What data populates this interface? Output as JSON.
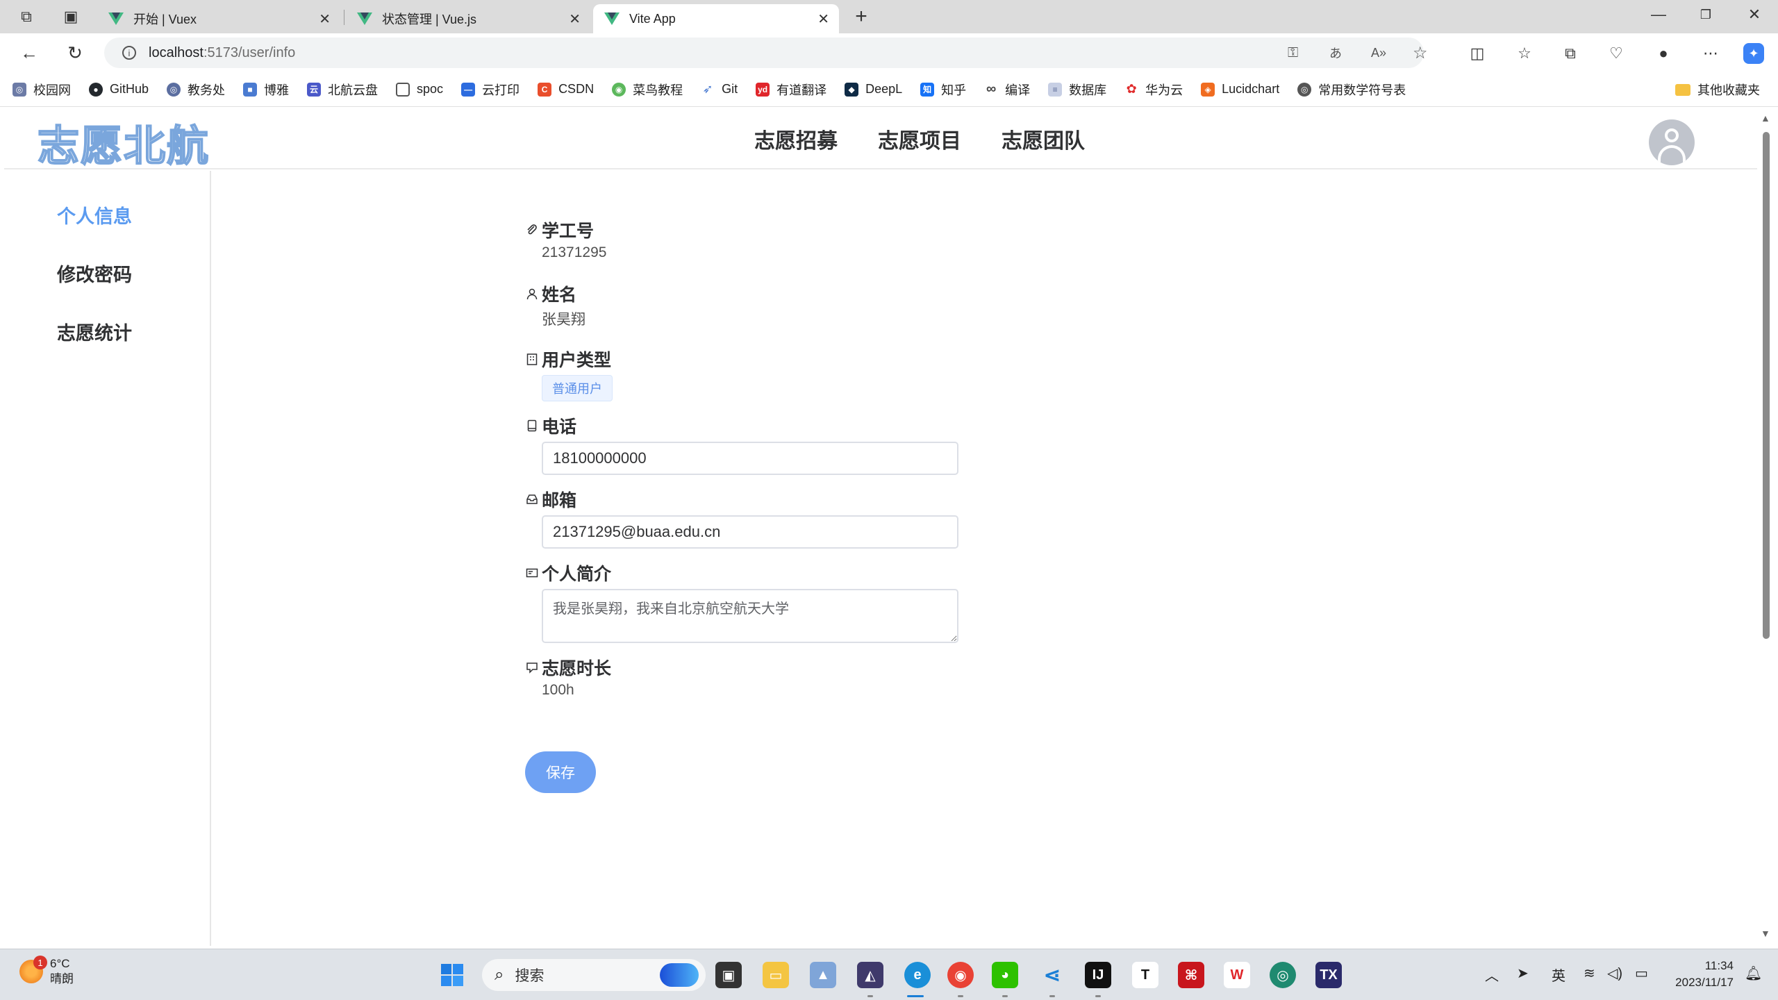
{
  "browser": {
    "tabs": [
      {
        "title": "开始 | Vuex"
      },
      {
        "title": "状态管理 | Vue.js"
      },
      {
        "title": "Vite App"
      }
    ],
    "new_tab": "+",
    "url_host": "localhost",
    "url_path": ":5173/user/info",
    "bookmarks": [
      {
        "label": "校园网",
        "color": "#6c7ba6",
        "glyph": "◎"
      },
      {
        "label": "GitHub",
        "color": "#24292e",
        "glyph": "●"
      },
      {
        "label": "教务处",
        "color": "#5b6ea0",
        "glyph": "◎"
      },
      {
        "label": "博雅",
        "color": "#4a7bd1",
        "glyph": "■"
      },
      {
        "label": "北航云盘",
        "color": "#4b59c9",
        "glyph": "云"
      },
      {
        "label": "spoc",
        "color": "#ffffff",
        "glyph": "□"
      },
      {
        "label": "云打印",
        "color": "#2d6cdf",
        "glyph": "—"
      },
      {
        "label": "CSDN",
        "color": "#e94e2c",
        "glyph": "C"
      },
      {
        "label": "菜鸟教程",
        "color": "#5cb85c",
        "glyph": "◉"
      },
      {
        "label": "Git",
        "color": "#4a7bd1",
        "glyph": "➶"
      },
      {
        "label": "有道翻译",
        "color": "#e0262b",
        "glyph": "yd"
      },
      {
        "label": "DeepL",
        "color": "#0f2b46",
        "glyph": "◆"
      },
      {
        "label": "知乎",
        "color": "#1772f6",
        "glyph": "知"
      },
      {
        "label": "编译",
        "color": "#444444",
        "glyph": "∞"
      },
      {
        "label": "数据库",
        "color": "#9aa6c7",
        "glyph": "≡"
      },
      {
        "label": "华为云",
        "color": "#e02b2b",
        "glyph": "✿"
      },
      {
        "label": "Lucidchart",
        "color": "#f06c20",
        "glyph": "◈"
      },
      {
        "label": "常用数学符号表",
        "color": "#555555",
        "glyph": "◎"
      }
    ],
    "other_bookmarks": "其他收藏夹"
  },
  "app": {
    "logo": "志愿北航",
    "nav": [
      "志愿招募",
      "志愿项目",
      "志愿团队"
    ],
    "sidebar": [
      {
        "label": "个人信息",
        "active": true
      },
      {
        "label": "修改密码",
        "active": false
      },
      {
        "label": "志愿统计",
        "active": false
      }
    ],
    "form": {
      "student_id": {
        "label": "学工号",
        "value": "21371295",
        "icon": "paperclip-icon"
      },
      "name": {
        "label": "姓名",
        "value": "张昊翔",
        "icon": "user-icon"
      },
      "user_type": {
        "label": "用户类型",
        "value": "普通用户",
        "icon": "office-building-icon"
      },
      "phone": {
        "label": "电话",
        "value": "18100000000",
        "icon": "cellphone-icon"
      },
      "email": {
        "label": "邮箱",
        "value": "21371295@buaa.edu.cn",
        "icon": "message-box-icon"
      },
      "intro": {
        "label": "个人简介",
        "value": "我是张昊翔，我来自北京航空航天大学",
        "icon": "postcard-icon"
      },
      "hours": {
        "label": "志愿时长",
        "value": "100h",
        "icon": "chat-square-icon"
      },
      "save_label": "保存"
    },
    "accent_color": "#5b9bf0"
  },
  "taskbar": {
    "weather_temp": "6°C",
    "weather_desc": "晴朗",
    "weather_badge": "1",
    "search_placeholder": "搜索",
    "ime": "英",
    "time": "11:34",
    "date": "2023/11/17"
  }
}
